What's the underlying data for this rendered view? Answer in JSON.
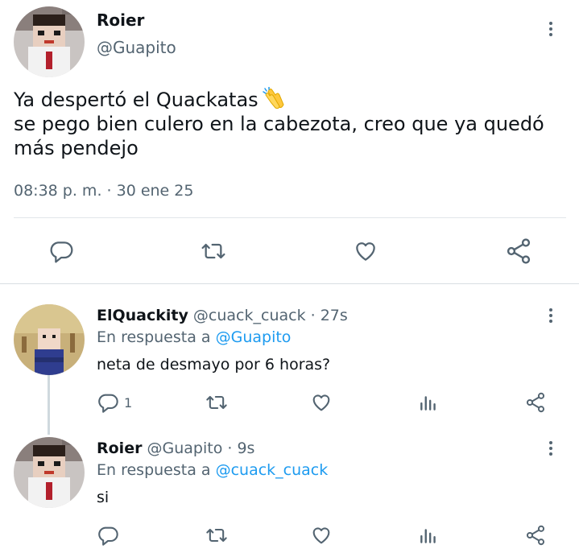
{
  "main_tweet": {
    "author_name": "Roier",
    "author_handle": "@Guapito",
    "text_line1": "Ya despertó el Quackatas",
    "emoji": "clapping-hands",
    "text_line2": "se pego bien culero en la cabezota, creo que ya quedó",
    "text_line3": "más pendejo",
    "timestamp": "08:38 p. m. · 30 ene 25",
    "actions": [
      "reply-icon",
      "retweet-icon",
      "like-icon",
      "share-icon"
    ]
  },
  "replies": [
    {
      "author_name": "ElQuackity",
      "author_handle": "@cuack_cuack",
      "time": "· 27s",
      "in_reply_prefix": "En respuesta a",
      "in_reply_to": "@Guapito",
      "text": "neta de desmayo por 6 horas?",
      "reply_count": "1"
    },
    {
      "author_name": "Roier",
      "author_handle": "@Guapito",
      "time": "· 9s",
      "in_reply_prefix": "En respuesta a",
      "in_reply_to": "@cuack_cuack",
      "text": "si",
      "reply_count": ""
    }
  ],
  "colors": {
    "text": "#0f1419",
    "secondary": "#536471",
    "mention": "#1d9bf0",
    "divider": "#e1e6ea"
  }
}
